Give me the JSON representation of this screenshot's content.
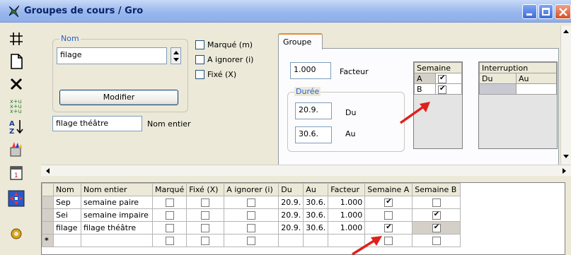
{
  "window": {
    "title": "Groupes de cours / Gro"
  },
  "form": {
    "nom_group_label": "Nom",
    "nom_value": "filage",
    "modifier_label": "Modifier",
    "nom_entier_value": "filage théâtre",
    "nom_entier_label": "Nom entier",
    "checkboxes": [
      {
        "label": "Marqué (m)",
        "checked": false
      },
      {
        "label": "A ignorer (i)",
        "checked": false
      },
      {
        "label": "Fixé (X)",
        "checked": false
      }
    ]
  },
  "tab": {
    "label": "Groupe",
    "facteur_value": "1.000",
    "facteur_label": "Facteur",
    "duree_label": "Durée",
    "du_value": "20.9.",
    "du_label": "Du",
    "au_value": "30.6.",
    "au_label": "Au",
    "semaine_header": "Semaine",
    "semaine_rows": [
      {
        "label": "A",
        "checked": true
      },
      {
        "label": "B",
        "checked": true
      }
    ],
    "interruption_header": "Interruption",
    "interruption_cols": [
      "Du",
      "Au"
    ]
  },
  "grid": {
    "columns": [
      "Nom",
      "Nom entier",
      "Marqué",
      "Fixé (X)",
      "A ignorer (i)",
      "Du",
      "Au",
      "Facteur",
      "Semaine A",
      "Semaine B"
    ],
    "rows": [
      {
        "nom": "Sep",
        "nom_entier": "semaine paire",
        "marque": false,
        "fixe": false,
        "ignorer": false,
        "du": "20.9.",
        "au": "30.6.",
        "facteur": "1.000",
        "semA": true,
        "semB": false
      },
      {
        "nom": "Sei",
        "nom_entier": "semaine impaire",
        "marque": false,
        "fixe": false,
        "ignorer": false,
        "du": "20.9.",
        "au": "30.6.",
        "facteur": "1.000",
        "semA": false,
        "semB": true
      },
      {
        "nom": "filage",
        "nom_entier": "filage théâtre",
        "marque": false,
        "fixe": false,
        "ignorer": false,
        "du": "20.9.",
        "au": "30.6.",
        "facteur": "1.000",
        "semA": true,
        "semB": true
      }
    ],
    "new_row_marker": "*"
  },
  "colors": {
    "accent_label": "#2B5DD1",
    "arrow": "#E0201A",
    "tab_highlight": "#E68B2C"
  },
  "icons": [
    "grid-icon",
    "new-document-icon",
    "delete-icon",
    "sort-replace-icon",
    "sort-az-icon",
    "paint-icon",
    "calendar-icon",
    "navigate-icon",
    "gear-icon"
  ]
}
